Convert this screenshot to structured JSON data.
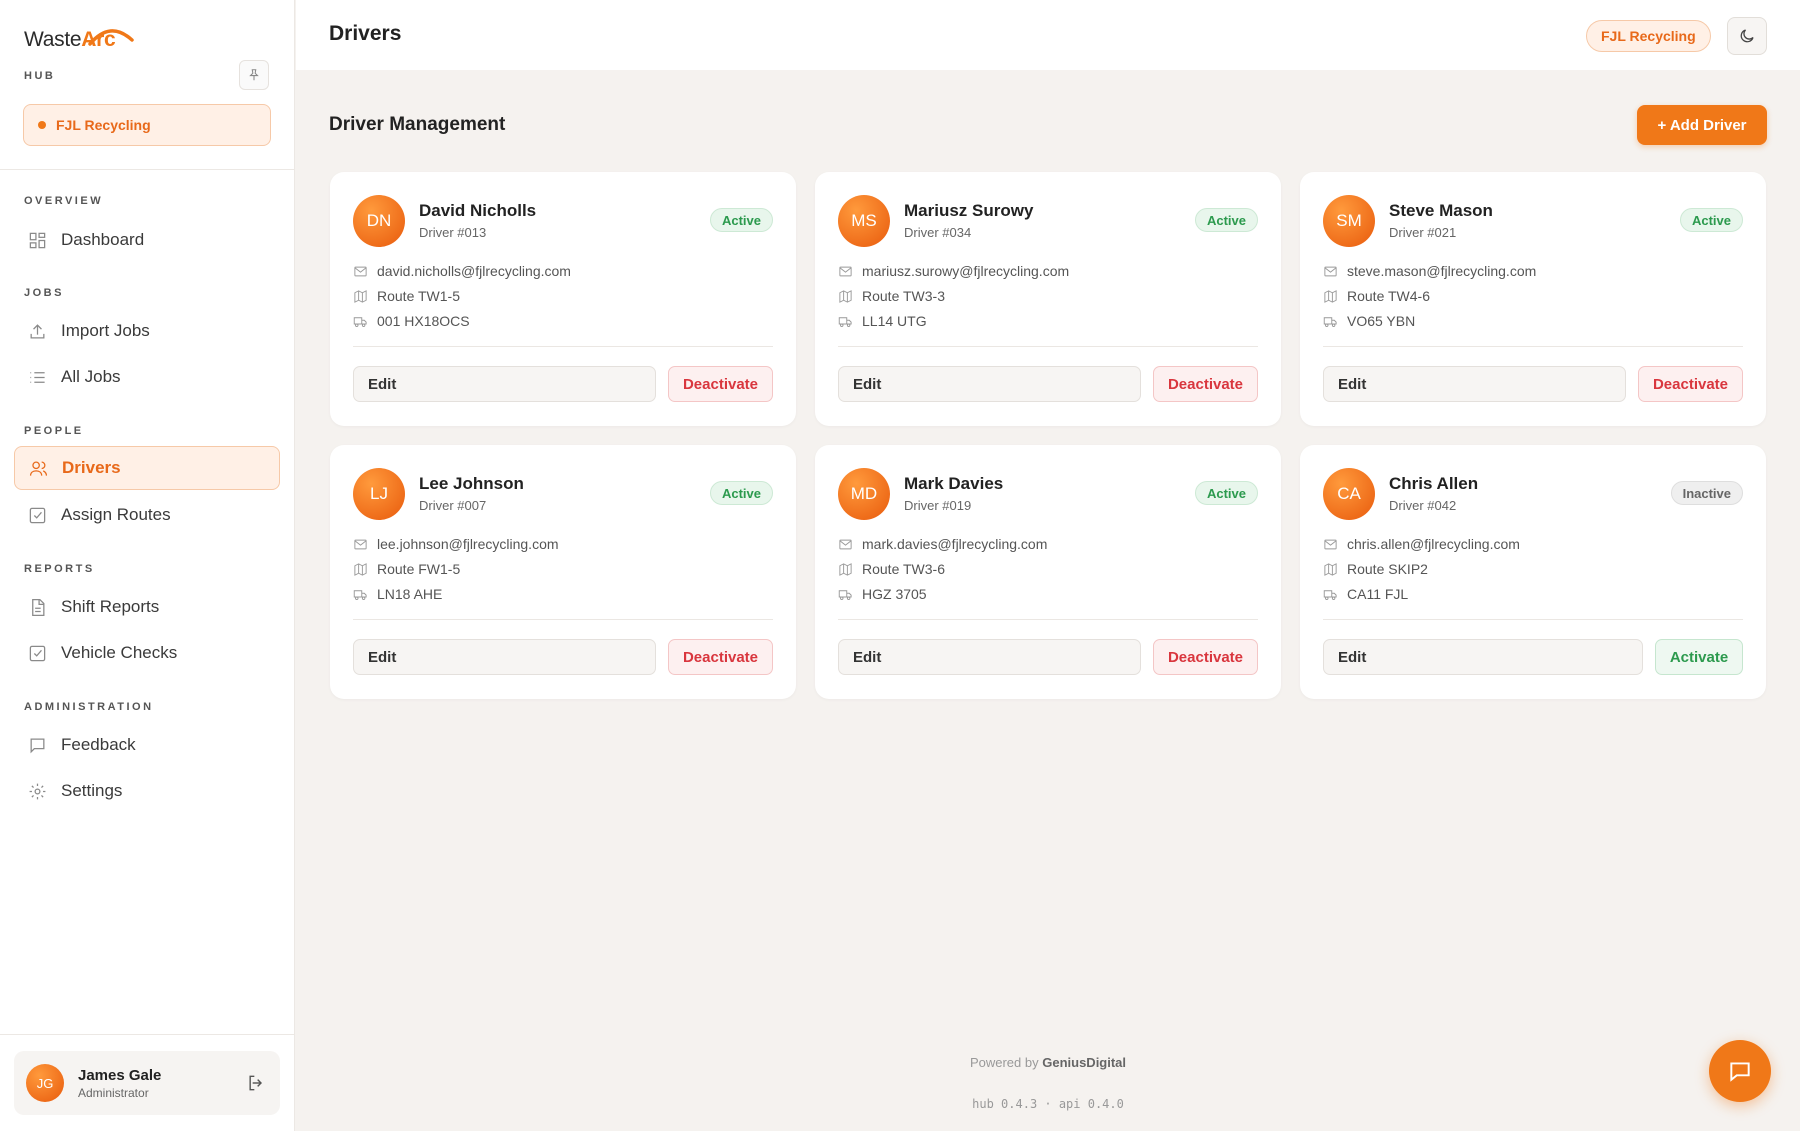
{
  "brand": {
    "logo_prefix": "Waste",
    "logo_suffix": "Arc",
    "hub_label": "HUB",
    "accent": "#f07818"
  },
  "org": {
    "name": "FJL Recycling"
  },
  "sidebar": {
    "sections": [
      {
        "label": "OVERVIEW",
        "items": [
          {
            "label": "Dashboard",
            "icon": "grid-icon"
          }
        ]
      },
      {
        "label": "JOBS",
        "items": [
          {
            "label": "Import Jobs",
            "icon": "upload-icon"
          },
          {
            "label": "All Jobs",
            "icon": "list-icon"
          }
        ]
      },
      {
        "label": "PEOPLE",
        "items": [
          {
            "label": "Drivers",
            "icon": "users-icon",
            "active": true
          },
          {
            "label": "Assign Routes",
            "icon": "checkbox-icon"
          }
        ]
      },
      {
        "label": "REPORTS",
        "items": [
          {
            "label": "Shift Reports",
            "icon": "document-icon"
          },
          {
            "label": "Vehicle Checks",
            "icon": "checkbox-icon"
          }
        ]
      },
      {
        "label": "ADMINISTRATION",
        "items": [
          {
            "label": "Feedback",
            "icon": "message-icon"
          },
          {
            "label": "Settings",
            "icon": "gear-icon"
          }
        ]
      }
    ]
  },
  "user": {
    "initials": "JG",
    "name": "James Gale",
    "role": "Administrator"
  },
  "header": {
    "title": "Drivers",
    "org_chip": "FJL Recycling"
  },
  "main": {
    "section_title": "Driver Management",
    "add_button": "+ Add Driver"
  },
  "drivers": [
    {
      "initials": "DN",
      "name": "David Nicholls",
      "number": "Driver #013",
      "status": "Active",
      "email": "david.nicholls@fjlrecycling.com",
      "route": "Route TW1-5",
      "vehicle": "001 HX18OCS",
      "edit": "Edit",
      "action": "Deactivate"
    },
    {
      "initials": "MS",
      "name": "Mariusz Surowy",
      "number": "Driver #034",
      "status": "Active",
      "email": "mariusz.surowy@fjlrecycling.com",
      "route": "Route TW3-3",
      "vehicle": "LL14 UTG",
      "edit": "Edit",
      "action": "Deactivate"
    },
    {
      "initials": "SM",
      "name": "Steve Mason",
      "number": "Driver #021",
      "status": "Active",
      "email": "steve.mason@fjlrecycling.com",
      "route": "Route TW4-6",
      "vehicle": "VO65 YBN",
      "edit": "Edit",
      "action": "Deactivate"
    },
    {
      "initials": "LJ",
      "name": "Lee Johnson",
      "number": "Driver #007",
      "status": "Active",
      "email": "lee.johnson@fjlrecycling.com",
      "route": "Route FW1-5",
      "vehicle": "LN18 AHE",
      "edit": "Edit",
      "action": "Deactivate"
    },
    {
      "initials": "MD",
      "name": "Mark Davies",
      "number": "Driver #019",
      "status": "Active",
      "email": "mark.davies@fjlrecycling.com",
      "route": "Route TW3-6",
      "vehicle": "HGZ 3705",
      "edit": "Edit",
      "action": "Deactivate"
    },
    {
      "initials": "CA",
      "name": "Chris Allen",
      "number": "Driver #042",
      "status": "Inactive",
      "email": "chris.allen@fjlrecycling.com",
      "route": "Route SKIP2",
      "vehicle": "CA11 FJL",
      "edit": "Edit",
      "action": "Activate"
    }
  ],
  "footer": {
    "powered_prefix": "Powered by",
    "powered_brand": "GeniusDigital",
    "version": "hub 0.4.3 · api 0.4.0"
  }
}
